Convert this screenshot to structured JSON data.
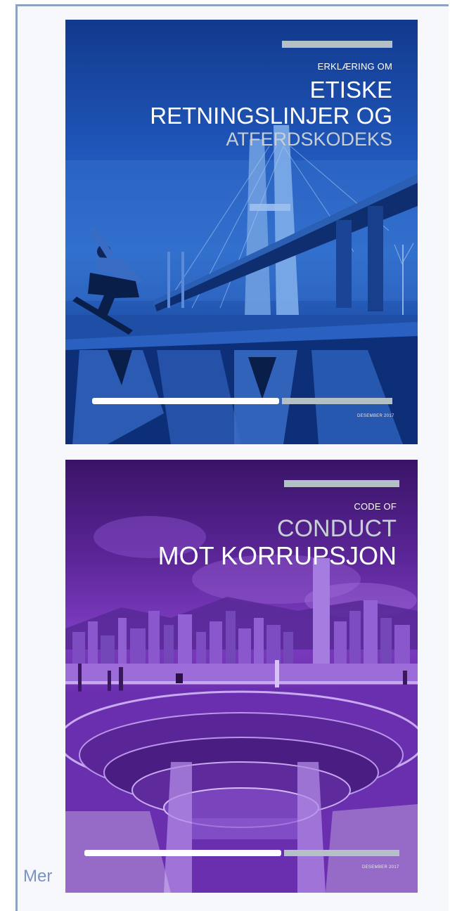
{
  "more_link": "Mer",
  "covers": [
    {
      "kicker": "ERKLÆRING OM",
      "title_line1": "ETISKE",
      "title_line2": "RETNINGSLINJER OG",
      "title_line3": "ATFERDSKODEKS",
      "date": "DESEMBER 2017",
      "theme_color": "#1f55b8"
    },
    {
      "kicker": "CODE OF",
      "title_line1": "CONDUCT",
      "title_line2": "MOT KORRUPSJON",
      "date": "DESEMBER 2017",
      "theme_color": "#7d3cc0"
    }
  ]
}
